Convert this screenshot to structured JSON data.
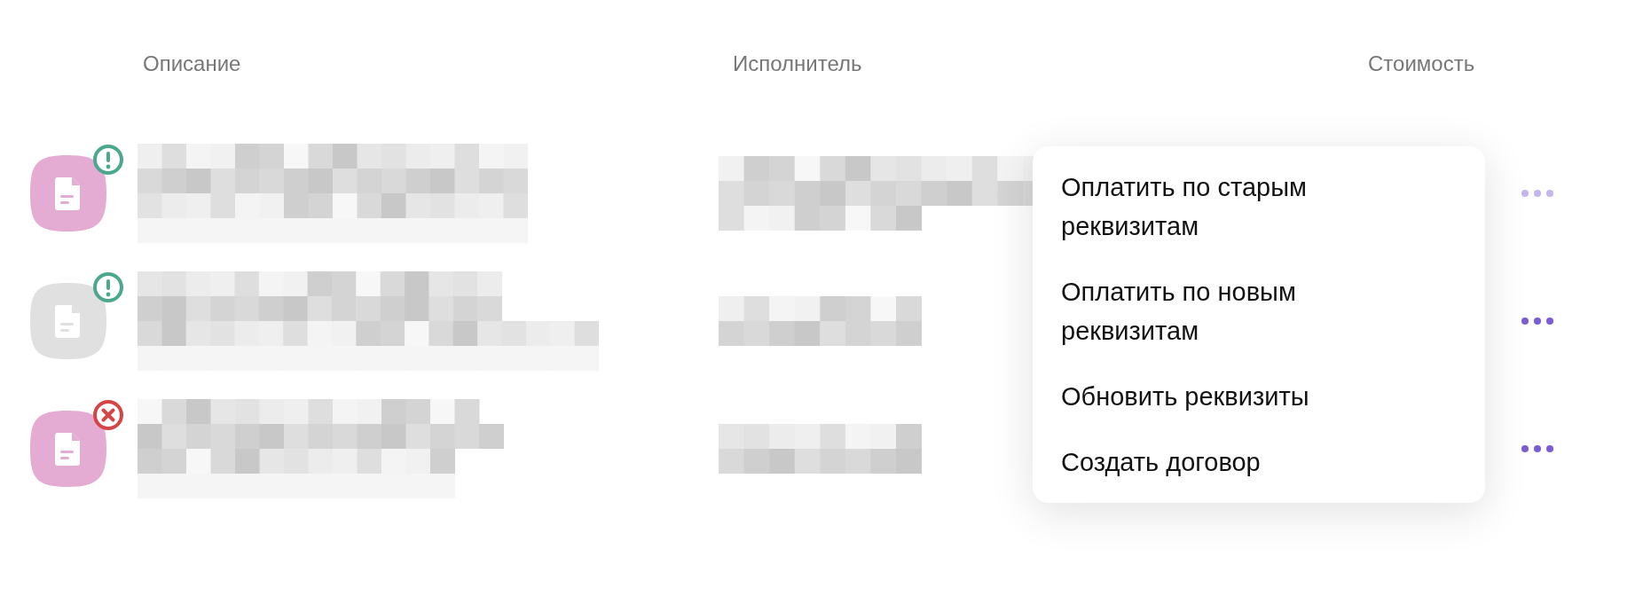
{
  "columns": [
    "Описание",
    "Исполнитель",
    "Стоимость"
  ],
  "rows": [
    {
      "color": "#e5acd3",
      "badge": {
        "kind": "warning"
      },
      "menu_open": true
    },
    {
      "color": "#e0e0e0",
      "badge": {
        "kind": "warning"
      },
      "menu_open": false
    },
    {
      "color": "#e5acd3",
      "badge": {
        "kind": "error"
      },
      "menu_open": false
    }
  ],
  "menu": {
    "items": [
      "Оплатить по старым реквизитам",
      "Оплатить по новым реквизитам",
      "Обновить реквизиты",
      "Создать договор"
    ]
  }
}
